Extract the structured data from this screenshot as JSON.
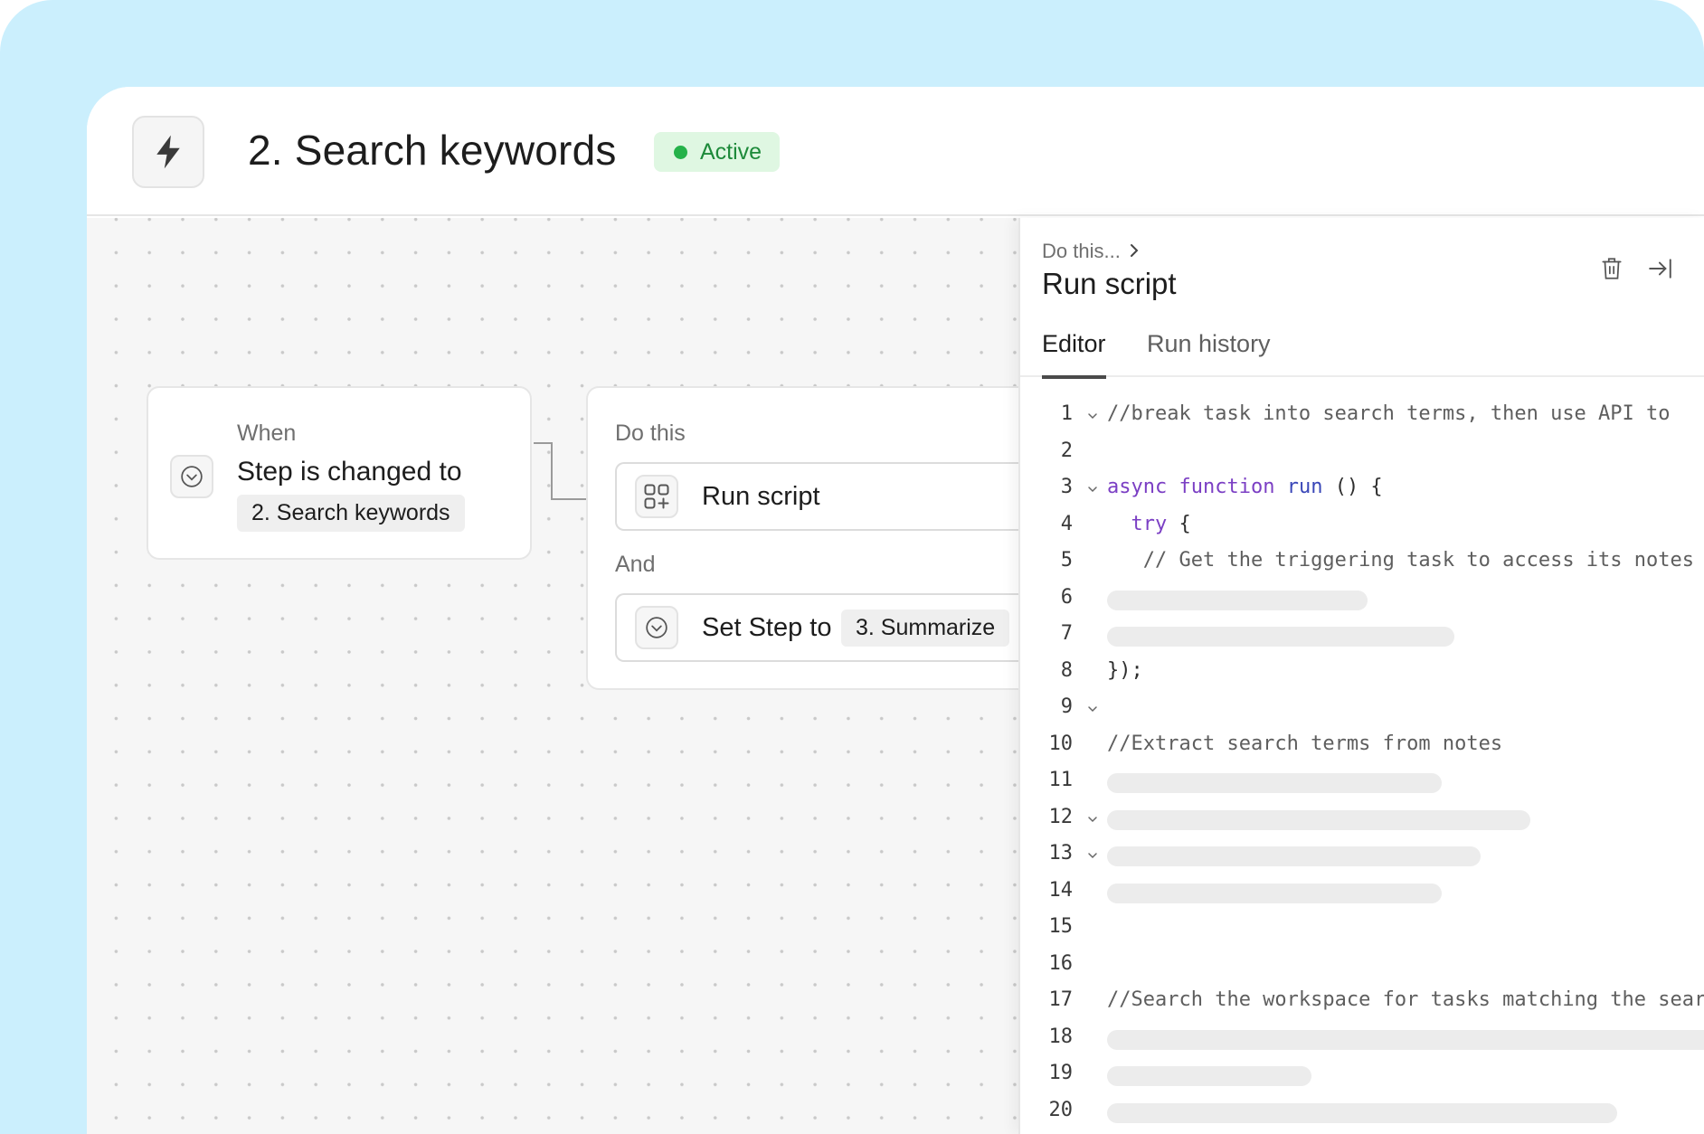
{
  "header": {
    "title": "2. Search keywords",
    "status": "Active",
    "icon": "lightning-bolt-icon"
  },
  "canvas": {
    "when_card": {
      "label": "When",
      "condition": "Step is changed to",
      "value": "2. Search keywords"
    },
    "do_card": {
      "label": "Do this",
      "action1": "Run script",
      "and_label": "And",
      "action2_prefix": "Set Step to",
      "action2_value": "3. Summarize"
    }
  },
  "panel": {
    "breadcrumb": "Do this...",
    "title": "Run script",
    "tabs": [
      "Editor",
      "Run history"
    ],
    "code_lines": [
      {
        "n": "1",
        "fold": true,
        "text": "//break task into search terms, then use API to"
      },
      {
        "n": "2",
        "fold": false,
        "text": ""
      },
      {
        "n": "3",
        "fold": true,
        "text": "async function run () {"
      },
      {
        "n": "4",
        "fold": false,
        "text": "  try {"
      },
      {
        "n": "5",
        "fold": false,
        "text": "   // Get the triggering task to access its notes"
      },
      {
        "n": "6",
        "fold": false,
        "text": ""
      },
      {
        "n": "7",
        "fold": false,
        "text": ""
      },
      {
        "n": "8",
        "fold": false,
        "text": "});"
      },
      {
        "n": "9",
        "fold": true,
        "text": ""
      },
      {
        "n": "10",
        "fold": false,
        "text": "//Extract search terms from notes"
      },
      {
        "n": "11",
        "fold": false,
        "text": ""
      },
      {
        "n": "12",
        "fold": true,
        "text": ""
      },
      {
        "n": "13",
        "fold": true,
        "text": ""
      },
      {
        "n": "14",
        "fold": false,
        "text": ""
      },
      {
        "n": "15",
        "fold": false,
        "text": ""
      },
      {
        "n": "16",
        "fold": false,
        "text": ""
      },
      {
        "n": "17",
        "fold": false,
        "text": "//Search the workspace for tasks matching the search"
      },
      {
        "n": "18",
        "fold": false,
        "text": ""
      },
      {
        "n": "19",
        "fold": false,
        "text": ""
      },
      {
        "n": "20",
        "fold": false,
        "text": ""
      }
    ]
  },
  "colors": {
    "background": "#cbeffd",
    "active_green": "#25b24a",
    "keyword_purple": "#7b3fc4"
  }
}
